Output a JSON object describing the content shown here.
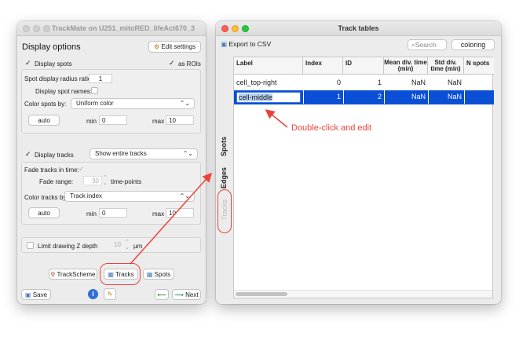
{
  "left_window": {
    "title": "TrackMate on U251_mitoRED_lifeAct670_3",
    "display_options_title": "Display options",
    "edit_settings_label": "Edit settings",
    "display_spots_label": "Display spots",
    "display_spots_checked": true,
    "as_rois_label": "as ROIs",
    "as_rois_checked": true,
    "spot_radius_label": "Spot display radius ratio:",
    "spot_radius_value": "1",
    "spot_names_label": "Display spot names:",
    "spot_names_checked": false,
    "color_spots_label": "Color spots by:",
    "color_spots_value": "Uniform color",
    "spots_auto_label": "auto",
    "spots_min_label": "min",
    "spots_min_value": "0",
    "spots_max_label": "max",
    "spots_max_value": "10",
    "display_tracks_label": "Display tracks",
    "display_tracks_checked": true,
    "track_mode_value": "Show entire tracks",
    "fade_label": "Fade tracks in time:",
    "fade_checked": true,
    "fade_range_label": "Fade range:",
    "fade_range_value": "30",
    "time_points_label": "time-points",
    "color_tracks_label": "Color tracks by:",
    "color_tracks_value": "Track index",
    "tracks_auto_label": "auto",
    "tracks_min_label": "min",
    "tracks_min_value": "0",
    "tracks_max_label": "max",
    "tracks_max_value": "10",
    "limit_z_label": "Limit drawing Z depth",
    "limit_z_checked": false,
    "z_value": "10",
    "z_unit": "µm",
    "trackscheme_label": "TrackScheme",
    "tracks_label": "Tracks",
    "spots_label": "Spots",
    "save_label": "Save",
    "next_label": "Next"
  },
  "right_window": {
    "title": "Track tables",
    "export_label": "Export to CSV",
    "search_placeholder": "Search",
    "coloring_label": "coloring",
    "columns": [
      "Label",
      "Index",
      "ID",
      "Mean div. time (min)",
      "Std div. time (min)",
      "N spots"
    ],
    "rows": [
      {
        "label": "cell_top-right",
        "index": "0",
        "id": "1",
        "mean": "NaN",
        "std": "NaN",
        "nspots": ""
      },
      {
        "label": "cell-middle",
        "index": "1",
        "id": "2",
        "mean": "NaN",
        "std": "NaN",
        "nspots": ""
      }
    ],
    "vertical_tabs": [
      "Spots",
      "Edges",
      "Tracks"
    ]
  },
  "annotation": {
    "text": "Double-click and edit",
    "color": "#e8433b"
  },
  "colors": {
    "selection": "#0a4fd6",
    "annotation_red": "#e8433b"
  }
}
